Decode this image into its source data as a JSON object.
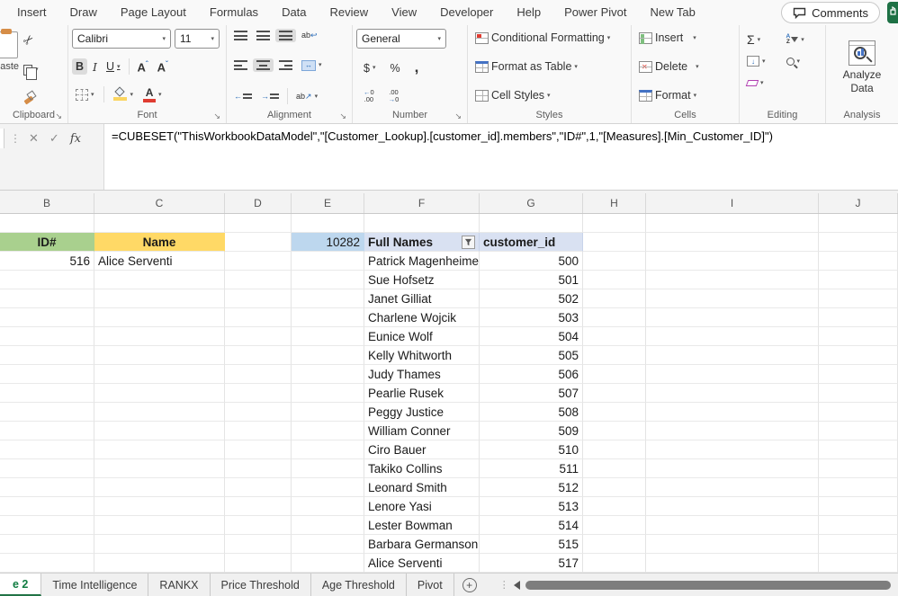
{
  "menu": {
    "tabs": [
      "Insert",
      "Draw",
      "Page Layout",
      "Formulas",
      "Data",
      "Review",
      "View",
      "Developer",
      "Help",
      "Power Pivot",
      "New Tab"
    ],
    "comments_label": "Comments"
  },
  "ribbon": {
    "paste_label": "Paste",
    "font_name": "Calibri",
    "font_size": "11",
    "bold_label": "B",
    "italic_label": "I",
    "underline_label": "U",
    "number_format": "General",
    "currency_label": "$",
    "percent_label": "%",
    "styles_buttons": [
      "Conditional Formatting",
      "Format as Table",
      "Cell Styles"
    ],
    "cells_buttons": [
      "Insert",
      "Delete",
      "Format"
    ],
    "analyze_label": "Analyze Data",
    "group_labels": {
      "clipboard": "Clipboard",
      "font": "Font",
      "alignment": "Alignment",
      "number": "Number",
      "styles": "Styles",
      "cells": "Cells",
      "editing": "Editing",
      "analysis": "Analysis"
    }
  },
  "formula_bar": {
    "formula": "=CUBESET(\"ThisWorkbookDataModel\",\"[Customer_Lookup].[customer_id].members\",\"ID#\",1,\"[Measures].[Min_Customer_ID]\")"
  },
  "grid": {
    "columns": [
      "B",
      "C",
      "D",
      "E",
      "F",
      "G",
      "H",
      "I",
      "J"
    ],
    "lookup": {
      "id_header": "ID#",
      "name_header": "Name",
      "id_value": "516",
      "name_value": "Alice Serventi"
    },
    "table": {
      "count_value": "10282",
      "full_names_header": "Full Names",
      "customer_id_header": "customer_id",
      "rows": [
        {
          "name": "Patrick Magenheimer",
          "id": "500"
        },
        {
          "name": "Sue Hofsetz",
          "id": "501"
        },
        {
          "name": "Janet Gilliat",
          "id": "502"
        },
        {
          "name": "Charlene Wojcik",
          "id": "503"
        },
        {
          "name": "Eunice Wolf",
          "id": "504"
        },
        {
          "name": "Kelly Whitworth",
          "id": "505"
        },
        {
          "name": "Judy Thames",
          "id": "506"
        },
        {
          "name": "Pearlie Rusek",
          "id": "507"
        },
        {
          "name": "Peggy Justice",
          "id": "508"
        },
        {
          "name": "William Conner",
          "id": "509"
        },
        {
          "name": "Ciro Bauer",
          "id": "510"
        },
        {
          "name": "Takiko Collins",
          "id": "511"
        },
        {
          "name": "Leonard Smith",
          "id": "512"
        },
        {
          "name": "Lenore Yasi",
          "id": "513"
        },
        {
          "name": "Lester Bowman",
          "id": "514"
        },
        {
          "name": "Barbara Germanson",
          "id": "515"
        },
        {
          "name": "Alice Serventi",
          "id": "517"
        }
      ]
    }
  },
  "sheet_tabs": {
    "active": "e 2",
    "tabs": [
      "Time Intelligence",
      "RANKX",
      "Price Threshold",
      "Age Threshold",
      "Pivot"
    ]
  },
  "colors": {
    "accent_green": "#217346",
    "id_header_fill": "#a9d08e",
    "name_header_fill": "#ffd966",
    "count_fill": "#bdd7ee",
    "table_header_fill": "#d9e1f2"
  }
}
